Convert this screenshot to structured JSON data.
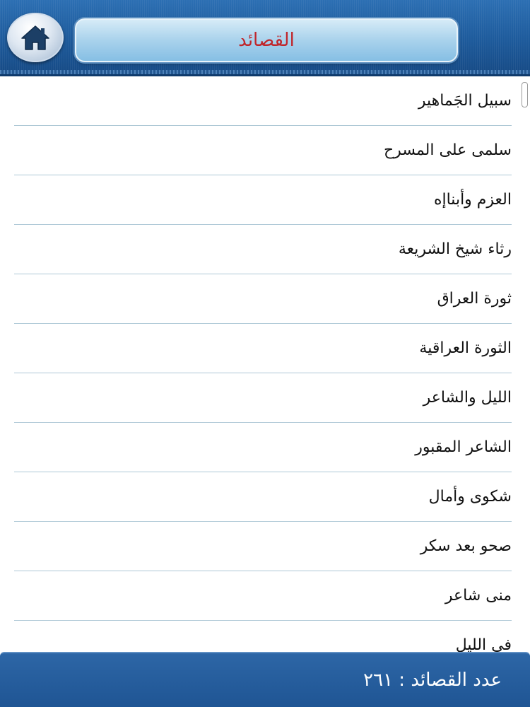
{
  "header": {
    "title": "القصائد",
    "home_icon": "home-icon"
  },
  "colors": {
    "header_blue": "#1d5a9b",
    "title_red": "#c0262b",
    "divider": "#aec8d6",
    "footer_blue": "#2d66a6"
  },
  "list": {
    "items": [
      {
        "label": "سبيل الجَماهير"
      },
      {
        "label": "سلمى على المسرح"
      },
      {
        "label": "العزم وأبناإه"
      },
      {
        "label": "رثاء شيخ الشريعة"
      },
      {
        "label": "ثورة العراق"
      },
      {
        "label": "الثورة العراقية"
      },
      {
        "label": "الليل والشاعر"
      },
      {
        "label": "الشاعر المقبور"
      },
      {
        "label": "شكوى وأمال"
      },
      {
        "label": "صحو بعد سكر"
      },
      {
        "label": "منى شاعر"
      },
      {
        "label": "في الليل"
      }
    ]
  },
  "footer": {
    "count_text": "عدد القصائد : ٢٦١"
  }
}
